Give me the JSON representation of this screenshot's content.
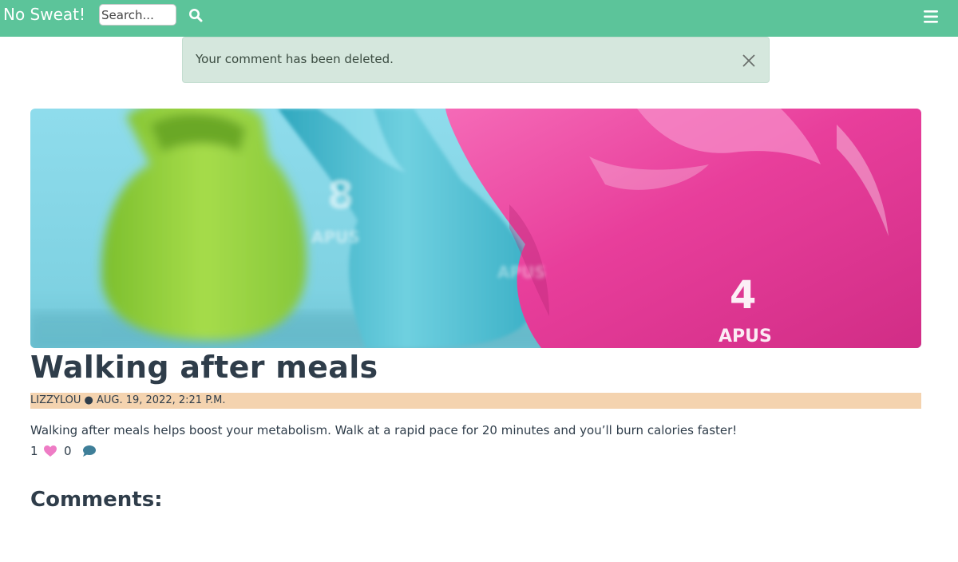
{
  "navbar": {
    "brand": "No Sweat!",
    "search_placeholder": "Search...",
    "search_icon": "search-icon",
    "menu_icon": "hamburger-menu-icon",
    "background_color": "#5cc49a"
  },
  "alert": {
    "message": "Your comment has been deleted.",
    "close_icon": "close-icon",
    "background_color": "#d5e7dd"
  },
  "hero": {
    "kettlebells": [
      {
        "color": "#8fc93a",
        "weight_label": "8",
        "brand_label": "APUS"
      },
      {
        "color": "#45b8cc",
        "weight_label": "",
        "brand_label": "APUS"
      },
      {
        "color": "#e83e9b",
        "weight_label": "4",
        "brand_label": "APUS"
      }
    ],
    "background_color": "#7fd6e8"
  },
  "post": {
    "title": "Walking after meals",
    "author": "LIZZYLOU",
    "separator": "●",
    "date": "AUG. 19, 2022, 2:21 P.M.",
    "meta_background": "#f4d3af",
    "body": "Walking after meals helps boost your metabolism. Walk at a rapid pace for 20 minutes and you’ll burn calories faster!",
    "likes": "1",
    "like_icon": "heart-icon",
    "like_color": "#ee7cc5",
    "comments_count": "0",
    "comment_icon": "comment-icon",
    "comment_color": "#3f7f99"
  },
  "comments": {
    "heading": "Comments:"
  }
}
